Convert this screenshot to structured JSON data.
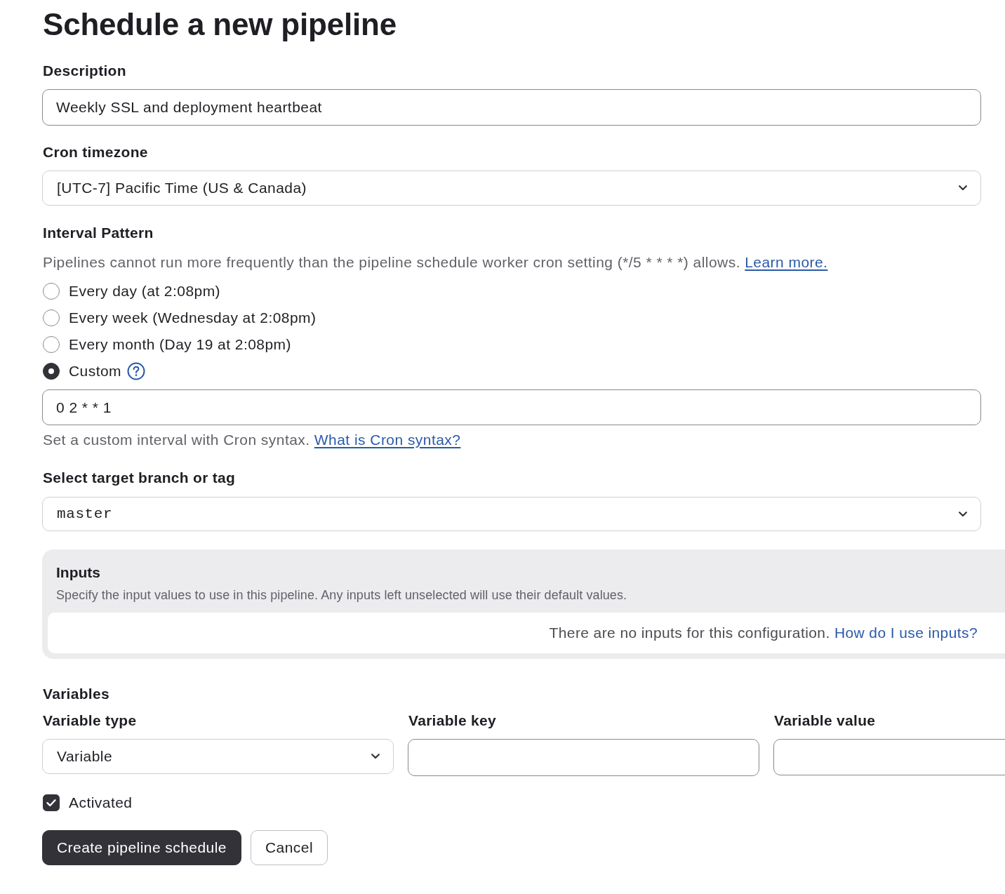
{
  "title": "Schedule a new pipeline",
  "description": {
    "label": "Description",
    "value": "Weekly SSL and deployment heartbeat"
  },
  "timezone": {
    "label": "Cron timezone",
    "value": "[UTC-7] Pacific Time (US & Canada)"
  },
  "interval": {
    "label": "Interval Pattern",
    "help": "Pipelines cannot run more frequently than the pipeline schedule worker cron setting (*/5 * * * *) allows.",
    "help_link": "Learn more.",
    "options": [
      {
        "label": "Every day (at 2:08pm)",
        "selected": false,
        "help_icon": false
      },
      {
        "label": "Every week (Wednesday at 2:08pm)",
        "selected": false,
        "help_icon": false
      },
      {
        "label": "Every month (Day 19 at 2:08pm)",
        "selected": false,
        "help_icon": false
      },
      {
        "label": "Custom",
        "selected": true,
        "help_icon": true
      }
    ],
    "custom_value": "0 2 * * 1",
    "custom_help": "Set a custom interval with Cron syntax.",
    "custom_help_link": "What is Cron syntax?"
  },
  "branch": {
    "label": "Select target branch or tag",
    "value": "master"
  },
  "inputs": {
    "title": "Inputs",
    "description": "Specify the input values to use in this pipeline. Any inputs left unselected will use their default values.",
    "empty_text": "There are no inputs for this configuration.",
    "empty_link": "How do I use inputs?"
  },
  "variables": {
    "title": "Variables",
    "columns": [
      {
        "label": "Variable type",
        "kind": "select",
        "value": "Variable"
      },
      {
        "label": "Variable key",
        "kind": "input"
      },
      {
        "label": "Variable value",
        "kind": "input"
      }
    ]
  },
  "activated": {
    "label": "Activated",
    "checked": true
  },
  "buttons": [
    {
      "label": "Create pipeline schedule",
      "kind": "primary"
    },
    {
      "label": "Cancel",
      "kind": "secondary"
    }
  ]
}
